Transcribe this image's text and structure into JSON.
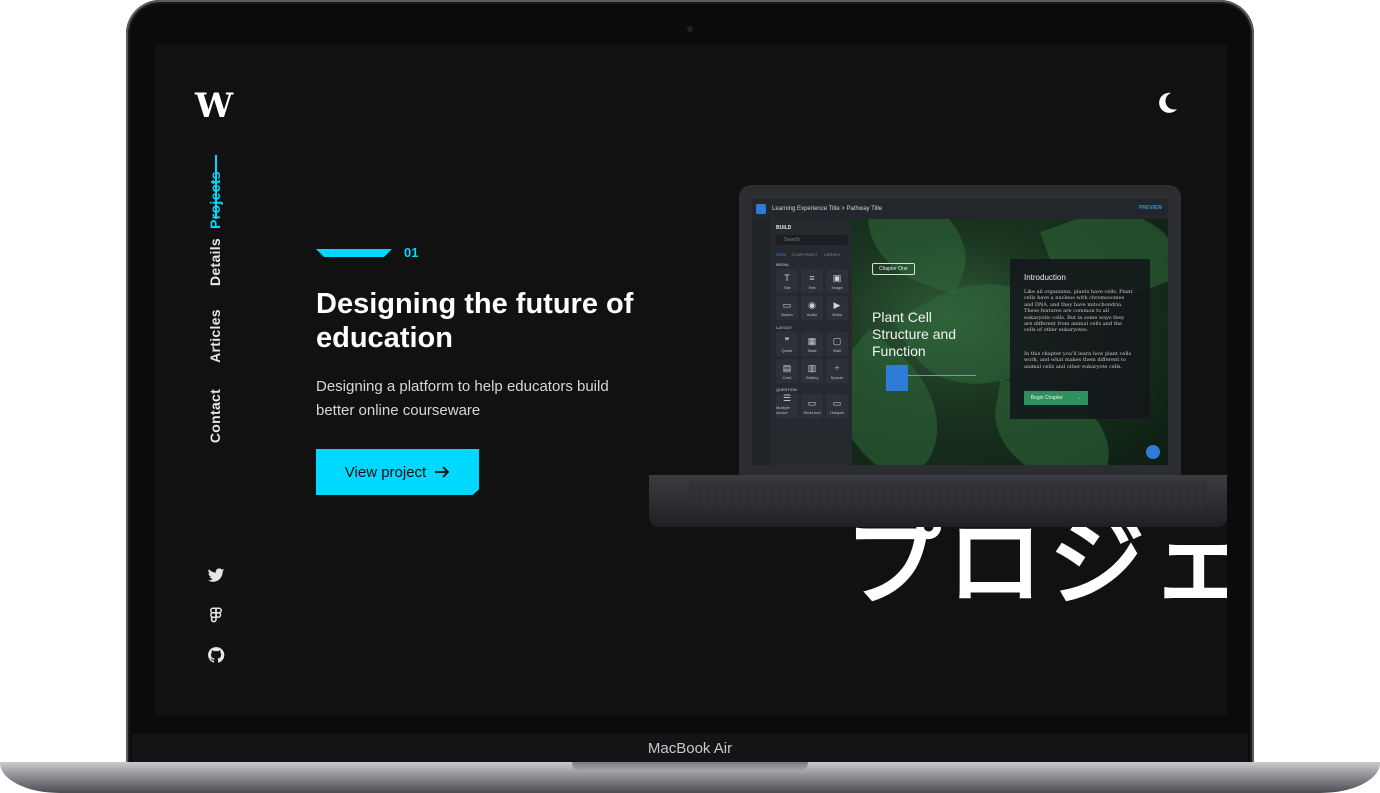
{
  "device": {
    "label": "MacBook Air"
  },
  "site": {
    "logo": "W",
    "nav": [
      {
        "label": "Projects",
        "active": true
      },
      {
        "label": "Details",
        "active": false
      },
      {
        "label": "Articles",
        "active": false
      },
      {
        "label": "Contact",
        "active": false
      }
    ],
    "social": [
      "twitter-icon",
      "figma-icon",
      "github-icon"
    ],
    "theme_toggle": "moon-icon"
  },
  "hero": {
    "index": "01",
    "title": "Designing the future of education",
    "subtitle": "Designing a platform to help educators build better online courseware",
    "cta_label": "View project",
    "cta_icon": "arrow-right-icon",
    "background_text": "プロジェクト",
    "accent_color": "#00d9ff"
  },
  "mockup": {
    "breadcrumb": "Learning Experience Title  >  Pathway Title",
    "preview_label": "PREVIEW",
    "sidebar_title": "BUILD",
    "search_placeholder": "Search",
    "tabs": [
      "ITEM",
      "COMPONENT",
      "LIBRARY"
    ],
    "sections": [
      {
        "label": "MEDIA",
        "items": [
          "Title",
          "Text",
          "Image",
          "Button",
          "Audio",
          "Video"
        ]
      },
      {
        "label": "LAYOUT",
        "items": [
          "Quote",
          "Table",
          "Wall",
          "Card",
          "Gallery",
          "Spacer"
        ]
      },
      {
        "label": "QUESTION",
        "items": [
          "Multiple choice",
          "Short text",
          "Hotspot"
        ]
      }
    ],
    "chapter_label": "Chapter One",
    "lesson_title": "Plant Cell Structure and Function",
    "intro_heading": "Introduction",
    "intro_body_1": "Like all organisms, plants have cells. Plant cells have a nucleus with chromosomes and DNA, and they have mitochondria. These features are common to all eukaryotic cells. But in some ways they are different from animal cells and the cells of other eukaryotes.",
    "intro_body_2": "In this chapter you'll learn how plant cells work, and what makes them different to animal cells and other eukaryote cells.",
    "begin_label": "Begin Chapter"
  }
}
